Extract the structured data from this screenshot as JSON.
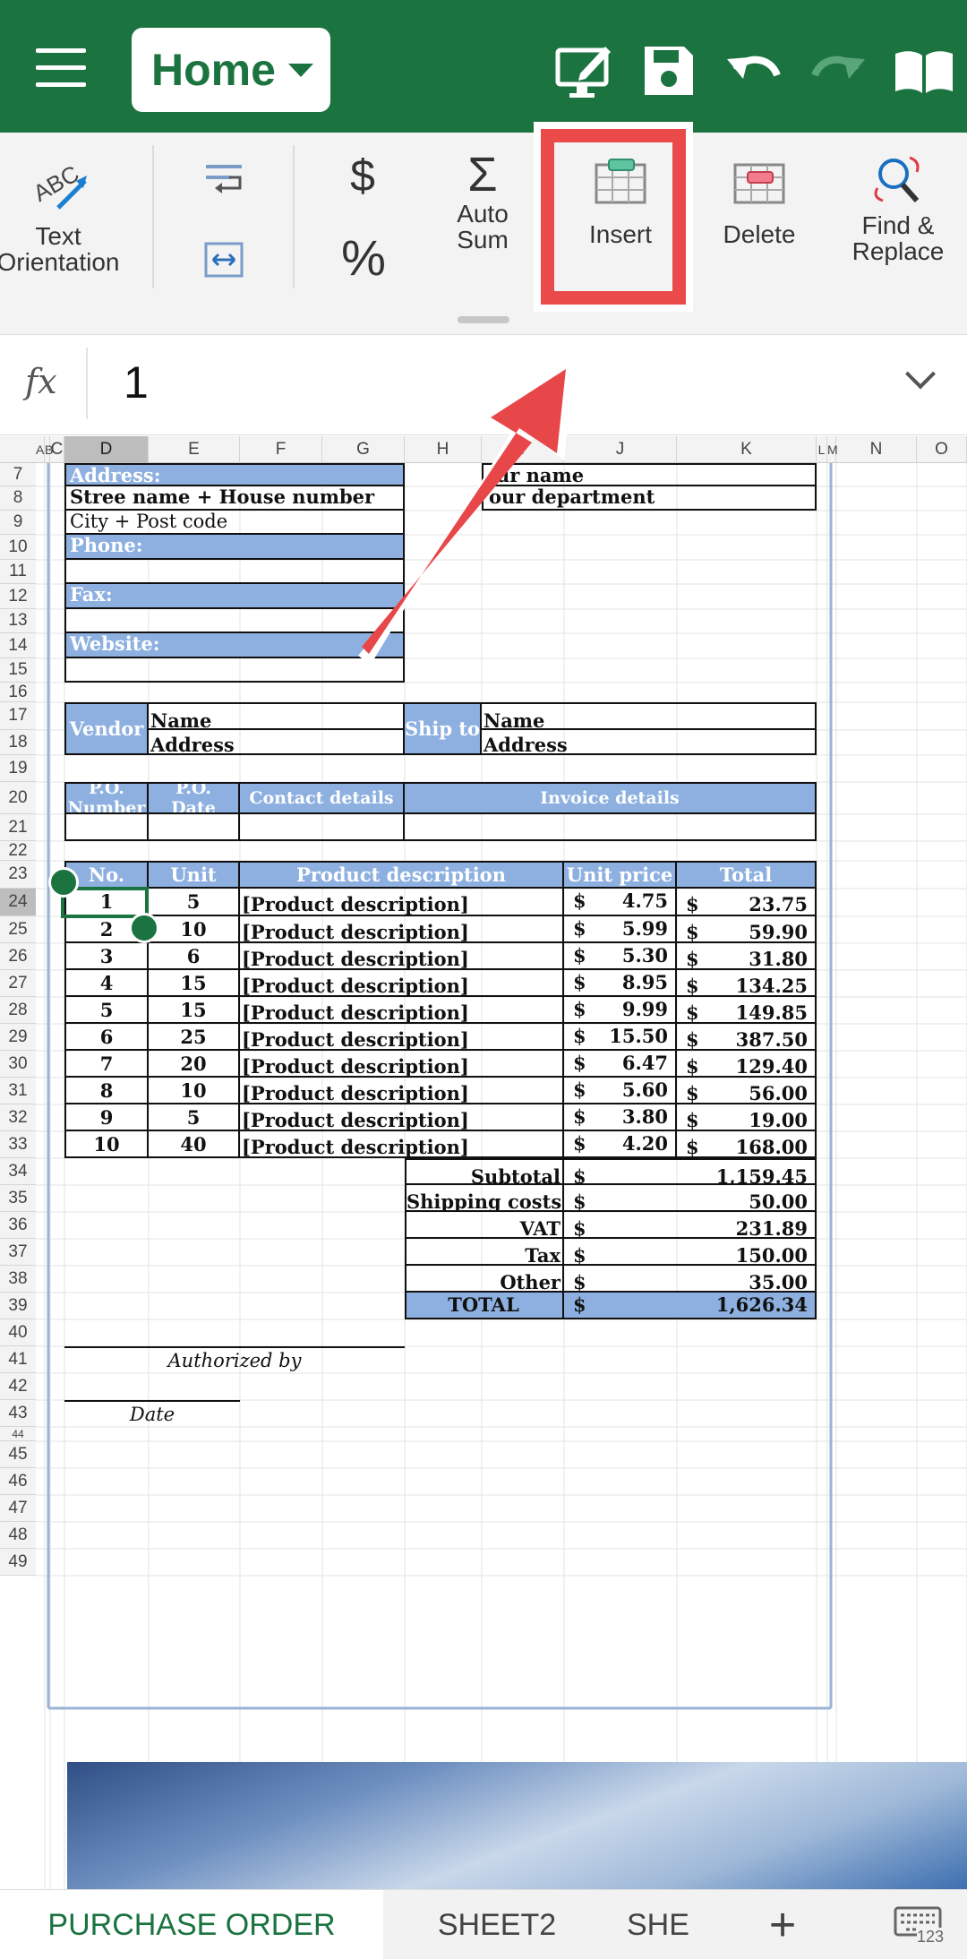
{
  "toolbar": {
    "home_label": "Home",
    "icons": [
      "menu-icon",
      "edit-sheet-icon",
      "save-icon",
      "undo-icon",
      "redo-icon",
      "read-mode-icon"
    ]
  },
  "ribbon": {
    "text_orientation": "Text\nOrientation",
    "auto_sum": "Auto\nSum",
    "insert": "Insert",
    "delete": "Delete",
    "find_replace": "Find &\nReplace",
    "dollar": "$",
    "percent": "%",
    "sigma": "Σ"
  },
  "formula": {
    "fx": "fx",
    "value": "1"
  },
  "columns": [
    "A",
    "B",
    "C",
    "D",
    "E",
    "F",
    "G",
    "H",
    "I",
    "J",
    "K",
    "L",
    "M",
    "N",
    "O"
  ],
  "rows": [
    "7",
    "8",
    "9",
    "10",
    "11",
    "12",
    "13",
    "14",
    "15",
    "16",
    "17",
    "18",
    "19",
    "20",
    "21",
    "22",
    "23",
    "24",
    "25",
    "26",
    "27",
    "28",
    "29",
    "30",
    "31",
    "32",
    "33",
    "34",
    "35",
    "36",
    "37",
    "38",
    "39",
    "40",
    "41",
    "42",
    "43",
    "44",
    "45",
    "46",
    "47",
    "48",
    "49"
  ],
  "form": {
    "address_label": "Address:",
    "street": "Stree name + House number",
    "city": "City + Post code",
    "phone_label": "Phone:",
    "fax_label": "Fax:",
    "website_label": "Website:",
    "your_name": "ur name",
    "your_department": "our department",
    "vendor": "Vendor",
    "ship_to": "Ship to",
    "name": "Name",
    "address": "Address",
    "po_number": "P.O.\nNumber",
    "po_date": "P.O.\nDate",
    "contact_details": "Contact details",
    "invoice_details": "Invoice details"
  },
  "table": {
    "headers": [
      "No.",
      "Unit",
      "Product description",
      "Unit price",
      "Total"
    ],
    "rows": [
      [
        "1",
        "5",
        "[Product description]",
        "4.75",
        "23.75"
      ],
      [
        "2",
        "10",
        "[Product description]",
        "5.99",
        "59.90"
      ],
      [
        "3",
        "6",
        "[Product description]",
        "5.30",
        "31.80"
      ],
      [
        "4",
        "15",
        "[Product description]",
        "8.95",
        "134.25"
      ],
      [
        "5",
        "15",
        "[Product description]",
        "9.99",
        "149.85"
      ],
      [
        "6",
        "25",
        "[Product description]",
        "15.50",
        "387.50"
      ],
      [
        "7",
        "20",
        "[Product description]",
        "6.47",
        "129.40"
      ],
      [
        "8",
        "10",
        "[Product description]",
        "5.60",
        "56.00"
      ],
      [
        "9",
        "5",
        "[Product description]",
        "3.80",
        "19.00"
      ],
      [
        "10",
        "40",
        "[Product description]",
        "4.20",
        "168.00"
      ]
    ],
    "currency": "$"
  },
  "summary": [
    {
      "label": "Subtotal",
      "value": "1,159.45"
    },
    {
      "label": "Shipping costs",
      "value": "50.00"
    },
    {
      "label": "VAT",
      "value": "231.89"
    },
    {
      "label": "Tax",
      "value": "150.00"
    },
    {
      "label": "Other",
      "value": "35.00"
    },
    {
      "label": "TOTAL",
      "value": "1,626.34"
    }
  ],
  "signature": {
    "authorized_by": "Authorized by",
    "date": "Date"
  },
  "tabs": {
    "tab1": "PURCHASE ORDER",
    "tab2": "SHEET2",
    "tab3": "SHE",
    "add": "+",
    "keyboard": "123"
  },
  "colors": {
    "brand_green": "#1b7340",
    "header_blue": "#8db0e0",
    "highlight_red": "#ea4a4a"
  }
}
